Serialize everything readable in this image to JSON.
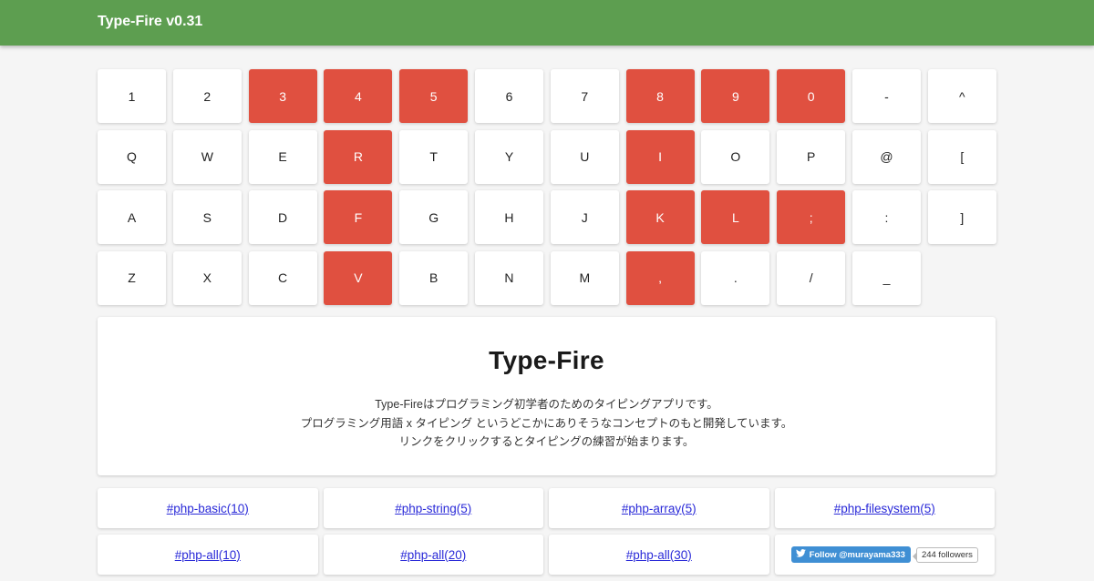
{
  "header": {
    "title": "Type-Fire v0.31"
  },
  "colors": {
    "header": "#5d9e50",
    "highlight_key": "#e05040",
    "link": "#2a2ad8",
    "twitter": "#3f8fd4"
  },
  "keyboard": {
    "rows": [
      [
        {
          "label": "1",
          "highlighted": false
        },
        {
          "label": "2",
          "highlighted": false
        },
        {
          "label": "3",
          "highlighted": true
        },
        {
          "label": "4",
          "highlighted": true
        },
        {
          "label": "5",
          "highlighted": true
        },
        {
          "label": "6",
          "highlighted": false
        },
        {
          "label": "7",
          "highlighted": false
        },
        {
          "label": "8",
          "highlighted": true
        },
        {
          "label": "9",
          "highlighted": true
        },
        {
          "label": "0",
          "highlighted": true
        },
        {
          "label": "-",
          "highlighted": false
        },
        {
          "label": "^",
          "highlighted": false
        }
      ],
      [
        {
          "label": "Q",
          "highlighted": false
        },
        {
          "label": "W",
          "highlighted": false
        },
        {
          "label": "E",
          "highlighted": false
        },
        {
          "label": "R",
          "highlighted": true
        },
        {
          "label": "T",
          "highlighted": false
        },
        {
          "label": "Y",
          "highlighted": false
        },
        {
          "label": "U",
          "highlighted": false
        },
        {
          "label": "I",
          "highlighted": true
        },
        {
          "label": "O",
          "highlighted": false
        },
        {
          "label": "P",
          "highlighted": false
        },
        {
          "label": "@",
          "highlighted": false
        },
        {
          "label": "[",
          "highlighted": false
        }
      ],
      [
        {
          "label": "A",
          "highlighted": false
        },
        {
          "label": "S",
          "highlighted": false
        },
        {
          "label": "D",
          "highlighted": false
        },
        {
          "label": "F",
          "highlighted": true
        },
        {
          "label": "G",
          "highlighted": false
        },
        {
          "label": "H",
          "highlighted": false
        },
        {
          "label": "J",
          "highlighted": false
        },
        {
          "label": "K",
          "highlighted": true
        },
        {
          "label": "L",
          "highlighted": true
        },
        {
          "label": ";",
          "highlighted": true
        },
        {
          "label": ":",
          "highlighted": false
        },
        {
          "label": "]",
          "highlighted": false
        }
      ],
      [
        {
          "label": "Z",
          "highlighted": false
        },
        {
          "label": "X",
          "highlighted": false
        },
        {
          "label": "C",
          "highlighted": false
        },
        {
          "label": "V",
          "highlighted": true
        },
        {
          "label": "B",
          "highlighted": false
        },
        {
          "label": "N",
          "highlighted": false
        },
        {
          "label": "M",
          "highlighted": false
        },
        {
          "label": ",",
          "highlighted": true
        },
        {
          "label": ".",
          "highlighted": false
        },
        {
          "label": "/",
          "highlighted": false
        },
        {
          "label": "_",
          "highlighted": false
        }
      ]
    ]
  },
  "intro": {
    "title": "Type-Fire",
    "line1": "Type-Fireはプログラミング初学者のためのタイピングアプリです。",
    "line2": "プログラミング用語 x タイピング というどこかにありそうなコンセプトのもと開発しています。",
    "line3": "リンクをクリックするとタイピングの練習が始まります。"
  },
  "links": [
    [
      "#php-basic(10)",
      "#php-string(5)",
      "#php-array(5)",
      "#php-filesystem(5)"
    ],
    [
      "#php-all(10)",
      "#php-all(20)",
      "#php-all(30)"
    ]
  ],
  "twitter": {
    "icon": "twitter-bird-icon",
    "follow_label": "Follow @murayama333",
    "followers": "244 followers"
  }
}
